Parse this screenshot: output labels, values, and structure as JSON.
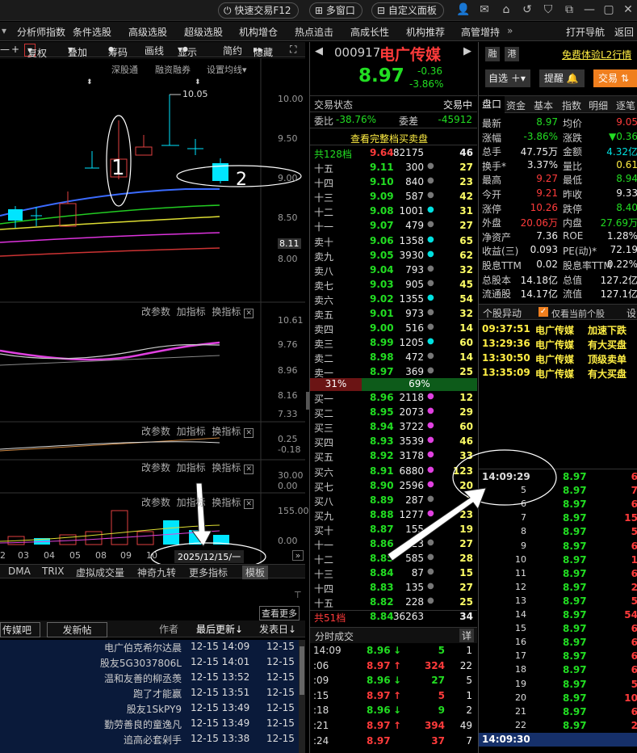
{
  "topbar": {
    "quick_trade": "快速交易F12",
    "multi_window": "多窗口",
    "custom_panel": "自定义面板"
  },
  "menu": {
    "items": [
      "分析师指数",
      "条件选股",
      "高级选股",
      "超级选股",
      "机构增仓",
      "热点追击",
      "高成长性",
      "机构推荐",
      "高管增持"
    ],
    "more": "»",
    "open_nav": "打开导航",
    "back": "返回"
  },
  "chart_toolbar": {
    "minus": "—",
    "plus": "+",
    "fuquan": "复权",
    "overlay": "叠加",
    "chips": "筹码",
    "draw": "画线",
    "display": "显示",
    "simple": "简约",
    "hide": "隐藏"
  },
  "chart_links": {
    "sgt": "深股通",
    "margin": "融资融券",
    "ma_settings": "设置均线"
  },
  "price_axis": {
    "t1": "10.00",
    "t2": "9.50",
    "t3": "9.00",
    "t4": "8.50",
    "t5": "8.11",
    "t6": "8.00",
    "high_label": "10.05"
  },
  "indicator_panes": [
    {
      "edit": "改参数",
      "add": "加指标",
      "swap": "换指标",
      "ticks": [
        "10.61",
        "9.76",
        "8.96",
        "8.16",
        "7.33"
      ]
    },
    {
      "edit": "改参数",
      "add": "加指标",
      "swap": "换指标",
      "ticks": [
        "0.25",
        "-0.18"
      ]
    },
    {
      "edit": "改参数",
      "add": "加指标",
      "swap": "换指标",
      "ticks": [
        "30.00",
        "0.00"
      ]
    },
    {
      "edit": "改参数",
      "add": "加指标",
      "swap": "换指标",
      "ticks": [
        "155.00",
        "0.00"
      ]
    }
  ],
  "x_axis": {
    "labels": [
      "2",
      "03",
      "04",
      "05",
      "08",
      "09",
      "10"
    ],
    "cursor_date": "2025/12/15/一"
  },
  "annotations": {
    "n1": "1",
    "n2": "2"
  },
  "bottom_tabs": {
    "t1": "DMA",
    "t2": "TRIX",
    "t3": "虚拟成交量",
    "t4": "神奇九转",
    "t5": "更多指标",
    "t6": "模板"
  },
  "forum": {
    "more": "查看更多",
    "tab1": "传媒吧",
    "tab2": "发新帖",
    "col_author": "作者",
    "col_latest": "最后更新↓",
    "col_post": "发表日↓",
    "rows": [
      {
        "user": "电广伯克希尔达晨",
        "time": "12-15 14:09",
        "date": "12-15"
      },
      {
        "user": "股友5G3037806L",
        "time": "12-15 14:01",
        "date": "12-15"
      },
      {
        "user": "温和友善的柳丞羡",
        "time": "12-15 13:52",
        "date": "12-15"
      },
      {
        "user": "跑了才能赢",
        "time": "12-15 13:51",
        "date": "12-15"
      },
      {
        "user": "股友1SkPY9",
        "time": "12-15 13:49",
        "date": "12-15"
      },
      {
        "user": "勤劳善良的童逸凡",
        "time": "12-15 13:49",
        "date": "12-15"
      },
      {
        "user": "追高必套剁手",
        "time": "12-15 13:38",
        "date": "12-15"
      }
    ]
  },
  "stock": {
    "code": "000917",
    "name": "电广传媒",
    "price": "8.97",
    "change": "-0.36",
    "pct": "-3.86%",
    "rong": "融",
    "gang": "港",
    "free_l2": "免费体验L2行情",
    "watch_btn": "自选",
    "remind_btn": "提醒",
    "trade_btn": "交易"
  },
  "orderbook": {
    "status_label": "交易状态",
    "status_value": "交易中",
    "weibi_label": "委比",
    "weibi": "-38.76%",
    "weicha_label": "委差",
    "weicha": "-45912",
    "view_full": "查看完整档买卖盘",
    "sell_total": {
      "label": "共128档",
      "price": "9.64",
      "vol": "82175",
      "count": "46"
    },
    "sells": [
      {
        "l": "十五",
        "p": "9.11",
        "v": "300",
        "c": "27"
      },
      {
        "l": "十四",
        "p": "9.10",
        "v": "840",
        "c": "23"
      },
      {
        "l": "十三",
        "p": "9.09",
        "v": "587",
        "c": "42"
      },
      {
        "l": "十二",
        "p": "9.08",
        "v": "1001",
        "c": "31"
      },
      {
        "l": "十一",
        "p": "9.07",
        "v": "479",
        "c": "27"
      },
      {
        "l": "卖十",
        "p": "9.06",
        "v": "1358",
        "c": "65"
      },
      {
        "l": "卖九",
        "p": "9.05",
        "v": "3930",
        "c": "62"
      },
      {
        "l": "卖八",
        "p": "9.04",
        "v": "793",
        "c": "32"
      },
      {
        "l": "卖七",
        "p": "9.03",
        "v": "905",
        "c": "45"
      },
      {
        "l": "卖六",
        "p": "9.02",
        "v": "1355",
        "c": "54"
      },
      {
        "l": "卖五",
        "p": "9.01",
        "v": "973",
        "c": "32"
      },
      {
        "l": "卖四",
        "p": "9.00",
        "v": "516",
        "c": "14"
      },
      {
        "l": "卖三",
        "p": "8.99",
        "v": "1205",
        "c": "60"
      },
      {
        "l": "卖二",
        "p": "8.98",
        "v": "472",
        "c": "14"
      },
      {
        "l": "卖一",
        "p": "8.97",
        "v": "369",
        "c": "25"
      }
    ],
    "ratio_buy": "31%",
    "ratio_sell": "69%",
    "buys": [
      {
        "l": "买一",
        "p": "8.96",
        "v": "2118",
        "c": "12"
      },
      {
        "l": "买二",
        "p": "8.95",
        "v": "2073",
        "c": "29"
      },
      {
        "l": "买三",
        "p": "8.94",
        "v": "3722",
        "c": "60"
      },
      {
        "l": "买四",
        "p": "8.93",
        "v": "3539",
        "c": "46"
      },
      {
        "l": "买五",
        "p": "8.92",
        "v": "3178",
        "c": "33"
      },
      {
        "l": "买六",
        "p": "8.91",
        "v": "6880",
        "c": "123"
      },
      {
        "l": "买七",
        "p": "8.90",
        "v": "2596",
        "c": "20"
      },
      {
        "l": "买八",
        "p": "8.89",
        "v": "287",
        "c": "7"
      },
      {
        "l": "买九",
        "p": "8.88",
        "v": "1277",
        "c": "23"
      },
      {
        "l": "买十",
        "p": "8.87",
        "v": "155",
        "c": "19"
      },
      {
        "l": "十一",
        "p": "8.86",
        "v": "623",
        "c": "27"
      },
      {
        "l": "十二",
        "p": "8.85",
        "v": "585",
        "c": "28"
      },
      {
        "l": "十三",
        "p": "8.84",
        "v": "87",
        "c": "15"
      },
      {
        "l": "十四",
        "p": "8.83",
        "v": "135",
        "c": "27"
      },
      {
        "l": "十五",
        "p": "8.82",
        "v": "228",
        "c": "25"
      }
    ],
    "buy_total": {
      "label": "共51档",
      "price": "8.84",
      "vol": "36263",
      "count": "34"
    }
  },
  "fenshi": {
    "title": "分时成交",
    "detail": "详",
    "rows": [
      {
        "t": "14:09",
        "p": "8.96",
        "a": "↓",
        "v": "5",
        "n": "1"
      },
      {
        "t": ":06",
        "p": "8.97",
        "a": "↑",
        "v": "324",
        "n": "22"
      },
      {
        "t": ":09",
        "p": "8.96",
        "a": "↓",
        "v": "27",
        "n": "5"
      },
      {
        "t": ":15",
        "p": "8.97",
        "a": "↑",
        "v": "5",
        "n": "1"
      },
      {
        "t": ":18",
        "p": "8.96",
        "a": "↓",
        "v": "9",
        "n": "2"
      },
      {
        "t": ":21",
        "p": "8.97",
        "a": "↑",
        "v": "394",
        "n": "49"
      },
      {
        "t": ":24",
        "p": "8.97",
        "a": "",
        "v": "37",
        "n": "7"
      }
    ]
  },
  "pankou": {
    "tabs": [
      "盘口",
      "资金",
      "基本",
      "指数",
      "明细",
      "逐笔"
    ],
    "rows": [
      {
        "a": "最新",
        "b": "8.97",
        "bc": "grn",
        "c": "均价",
        "d": "9.05",
        "dc": "red"
      },
      {
        "a": "涨幅",
        "b": "-3.86%",
        "bc": "grn",
        "c": "涨跌",
        "d": "▼0.36",
        "dc": "grn"
      },
      {
        "a": "总手",
        "b": "47.75万",
        "bc": "wht",
        "c": "金额",
        "d": "4.32亿",
        "dc": "cyn"
      },
      {
        "a": "换手*",
        "b": "3.37%",
        "bc": "wht",
        "c": "量比",
        "d": "0.61",
        "dc": "yel"
      },
      {
        "a": "最高",
        "b": "9.27",
        "bc": "red",
        "c": "最低",
        "d": "8.94",
        "dc": "grn"
      },
      {
        "a": "今开",
        "b": "9.21",
        "bc": "red",
        "c": "昨收",
        "d": "9.33",
        "dc": "wht"
      },
      {
        "a": "涨停",
        "b": "10.26",
        "bc": "red",
        "c": "跌停",
        "d": "8.40",
        "dc": "grn"
      },
      {
        "a": "外盘",
        "b": "20.06万",
        "bc": "red",
        "c": "内盘",
        "d": "27.69万",
        "dc": "grn"
      },
      {
        "a": "净资产",
        "b": "7.36",
        "bc": "wht",
        "c": "ROE",
        "d": "1.28%",
        "dc": "wht"
      },
      {
        "a": "收益(三)",
        "b": "0.093",
        "bc": "wht",
        "c": "PE(动)*",
        "d": "72.19",
        "dc": "wht"
      },
      {
        "a": "股息TTM",
        "b": "0.02",
        "bc": "wht",
        "c": "股息率TTM",
        "d": "0.22%",
        "dc": "wht"
      },
      {
        "a": "总股本",
        "b": "14.18亿",
        "bc": "wht",
        "c": "总值",
        "d": "127.2亿",
        "dc": "wht"
      },
      {
        "a": "流通股",
        "b": "14.17亿",
        "bc": "wht",
        "c": "流值",
        "d": "127.1亿",
        "dc": "wht"
      }
    ]
  },
  "alerts": {
    "title": "个股异动",
    "only_current": "仅看当前个股",
    "settings": "设",
    "rows": [
      {
        "time": "09:37:51",
        "name": "电广传媒",
        "event": "加速下跌"
      },
      {
        "time": "13:29:36",
        "name": "电广传媒",
        "event": "有大买盘"
      },
      {
        "time": "13:30:50",
        "name": "电广传媒",
        "event": "顶级卖单"
      },
      {
        "time": "13:35:09",
        "name": "电广传媒",
        "event": "有大买盘"
      }
    ]
  },
  "ticks": {
    "head_time": "14:09:29",
    "foot_time": "14:09:30",
    "rows": [
      {
        "t": "",
        "p": "8.97",
        "v": "6"
      },
      {
        "t": "5",
        "p": "8.97",
        "v": "7"
      },
      {
        "t": "6",
        "p": "8.97",
        "v": "6"
      },
      {
        "t": "7",
        "p": "8.97",
        "v": "15"
      },
      {
        "t": "8",
        "p": "8.97",
        "v": "5"
      },
      {
        "t": "9",
        "p": "8.97",
        "v": "6"
      },
      {
        "t": "10",
        "p": "8.97",
        "v": "1"
      },
      {
        "t": "11",
        "p": "8.97",
        "v": "6"
      },
      {
        "t": "12",
        "p": "8.97",
        "v": "2"
      },
      {
        "t": "13",
        "p": "8.97",
        "v": "5"
      },
      {
        "t": "14",
        "p": "8.97",
        "v": "54"
      },
      {
        "t": "15",
        "p": "8.97",
        "v": "6"
      },
      {
        "t": "16",
        "p": "8.97",
        "v": "6"
      },
      {
        "t": "17",
        "p": "8.97",
        "v": "6"
      },
      {
        "t": "18",
        "p": "8.97",
        "v": "6"
      },
      {
        "t": "19",
        "p": "8.97",
        "v": "5"
      },
      {
        "t": "20",
        "p": "8.97",
        "v": "10"
      },
      {
        "t": "21",
        "p": "8.97",
        "v": "6"
      },
      {
        "t": "22",
        "p": "8.97",
        "v": "2"
      },
      {
        "t": "",
        "p": "8.97",
        "v": "5"
      }
    ]
  },
  "colors": {
    "up": "#ff3b3b",
    "down": "#22dd22",
    "accent_orange": "#f07f1e",
    "bg": "#000000",
    "panel_blue": "#0a1a3a"
  }
}
